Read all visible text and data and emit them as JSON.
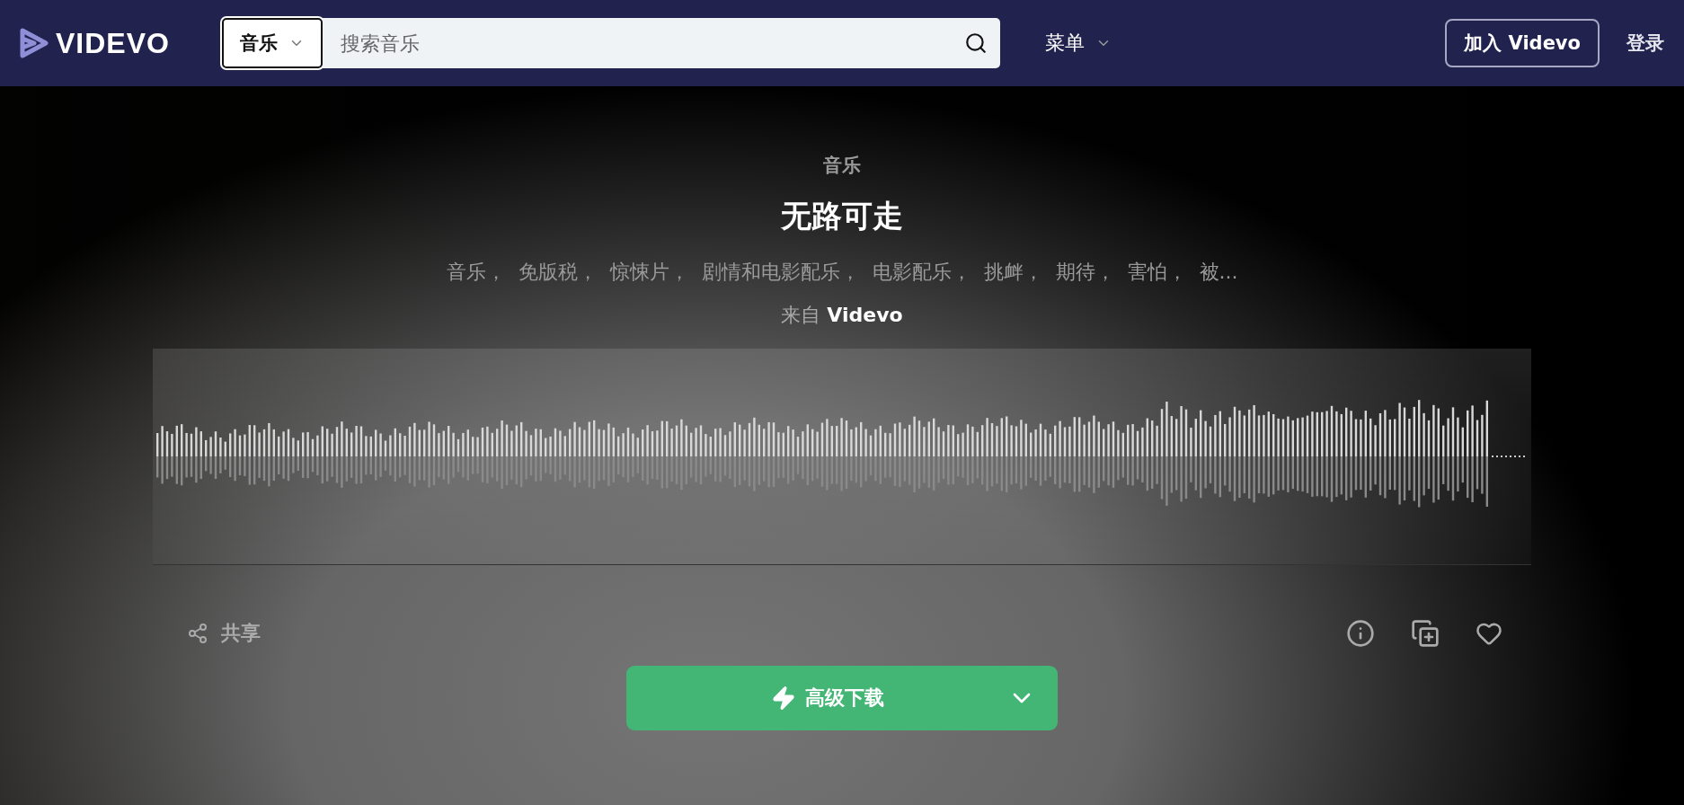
{
  "header": {
    "logo": "VIDEVO",
    "search": {
      "category": "音乐",
      "placeholder": "搜索音乐"
    },
    "menu": "菜单",
    "join_button": "加入 Videvo",
    "login": "登录"
  },
  "track": {
    "category": "音乐",
    "title": "无路可走",
    "tags": [
      "音乐，",
      "免版税，",
      "惊悚片，",
      "剧情和电影配乐，",
      "电影配乐，",
      "挑衅，",
      "期待，",
      "害怕，",
      "被..."
    ],
    "source": "来自 **Videvo**"
  },
  "actions": {
    "share": "共享"
  },
  "download": {
    "label": "高级下载"
  }
}
